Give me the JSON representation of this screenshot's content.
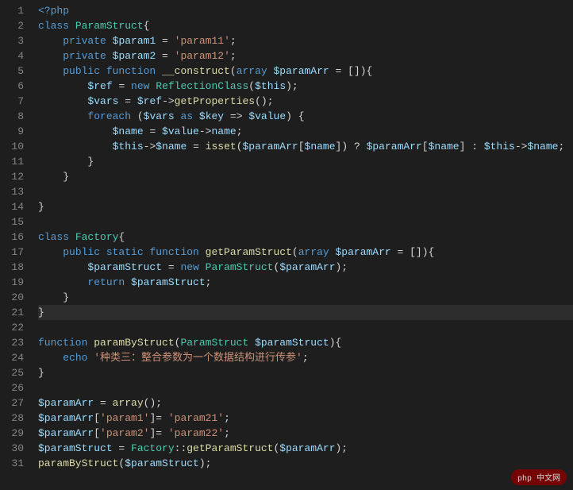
{
  "lines": [
    {
      "n": 1,
      "tokens": [
        {
          "t": "<?php",
          "c": "tok-keyword"
        }
      ]
    },
    {
      "n": 2,
      "tokens": [
        {
          "t": "class ",
          "c": "tok-keyword"
        },
        {
          "t": "ParamStruct",
          "c": "tok-type"
        },
        {
          "t": "{",
          "c": "tok-punct"
        }
      ]
    },
    {
      "n": 3,
      "indent": 1,
      "tokens": [
        {
          "t": "private ",
          "c": "tok-keyword"
        },
        {
          "t": "$param1",
          "c": "tok-var"
        },
        {
          "t": " = ",
          "c": "tok-op"
        },
        {
          "t": "'param11'",
          "c": "tok-string"
        },
        {
          "t": ";",
          "c": "tok-punct"
        }
      ]
    },
    {
      "n": 4,
      "indent": 1,
      "tokens": [
        {
          "t": "private ",
          "c": "tok-keyword"
        },
        {
          "t": "$param2",
          "c": "tok-var"
        },
        {
          "t": " = ",
          "c": "tok-op"
        },
        {
          "t": "'param12'",
          "c": "tok-string"
        },
        {
          "t": ";",
          "c": "tok-punct"
        }
      ]
    },
    {
      "n": 5,
      "indent": 1,
      "tokens": [
        {
          "t": "public ",
          "c": "tok-keyword"
        },
        {
          "t": "function ",
          "c": "tok-keyword"
        },
        {
          "t": "__construct",
          "c": "tok-func"
        },
        {
          "t": "(",
          "c": "tok-punct"
        },
        {
          "t": "array ",
          "c": "tok-keyword"
        },
        {
          "t": "$paramArr",
          "c": "tok-var"
        },
        {
          "t": " = []",
          "c": "tok-op"
        },
        {
          "t": "){",
          "c": "tok-punct"
        }
      ]
    },
    {
      "n": 6,
      "indent": 2,
      "tokens": [
        {
          "t": "$ref",
          "c": "tok-var"
        },
        {
          "t": " = ",
          "c": "tok-op"
        },
        {
          "t": "new ",
          "c": "tok-keyword"
        },
        {
          "t": "ReflectionClass",
          "c": "tok-type"
        },
        {
          "t": "(",
          "c": "tok-punct"
        },
        {
          "t": "$this",
          "c": "tok-var"
        },
        {
          "t": ");",
          "c": "tok-punct"
        }
      ]
    },
    {
      "n": 7,
      "indent": 2,
      "tokens": [
        {
          "t": "$vars",
          "c": "tok-var"
        },
        {
          "t": " = ",
          "c": "tok-op"
        },
        {
          "t": "$ref",
          "c": "tok-var"
        },
        {
          "t": "->",
          "c": "tok-op"
        },
        {
          "t": "getProperties",
          "c": "tok-func"
        },
        {
          "t": "();",
          "c": "tok-punct"
        }
      ]
    },
    {
      "n": 8,
      "indent": 2,
      "tokens": [
        {
          "t": "foreach ",
          "c": "tok-keyword"
        },
        {
          "t": "(",
          "c": "tok-punct"
        },
        {
          "t": "$vars",
          "c": "tok-var"
        },
        {
          "t": " as ",
          "c": "tok-keyword"
        },
        {
          "t": "$key",
          "c": "tok-var"
        },
        {
          "t": " => ",
          "c": "tok-op"
        },
        {
          "t": "$value",
          "c": "tok-var"
        },
        {
          "t": ") {",
          "c": "tok-punct"
        }
      ]
    },
    {
      "n": 9,
      "indent": 3,
      "tokens": [
        {
          "t": "$name",
          "c": "tok-var"
        },
        {
          "t": " = ",
          "c": "tok-op"
        },
        {
          "t": "$value",
          "c": "tok-var"
        },
        {
          "t": "->",
          "c": "tok-op"
        },
        {
          "t": "name",
          "c": "tok-var"
        },
        {
          "t": ";",
          "c": "tok-punct"
        }
      ]
    },
    {
      "n": 10,
      "indent": 3,
      "tokens": [
        {
          "t": "$this",
          "c": "tok-var"
        },
        {
          "t": "->",
          "c": "tok-op"
        },
        {
          "t": "$name",
          "c": "tok-var"
        },
        {
          "t": " = ",
          "c": "tok-op"
        },
        {
          "t": "isset",
          "c": "tok-func"
        },
        {
          "t": "(",
          "c": "tok-punct"
        },
        {
          "t": "$paramArr",
          "c": "tok-var"
        },
        {
          "t": "[",
          "c": "tok-punct"
        },
        {
          "t": "$name",
          "c": "tok-var"
        },
        {
          "t": "]) ? ",
          "c": "tok-punct"
        },
        {
          "t": "$paramArr",
          "c": "tok-var"
        },
        {
          "t": "[",
          "c": "tok-punct"
        },
        {
          "t": "$name",
          "c": "tok-var"
        },
        {
          "t": "] : ",
          "c": "tok-punct"
        },
        {
          "t": "$this",
          "c": "tok-var"
        },
        {
          "t": "->",
          "c": "tok-op"
        },
        {
          "t": "$name",
          "c": "tok-var"
        },
        {
          "t": ";",
          "c": "tok-punct"
        }
      ]
    },
    {
      "n": 11,
      "indent": 2,
      "tokens": [
        {
          "t": "}",
          "c": "tok-punct"
        }
      ]
    },
    {
      "n": 12,
      "indent": 1,
      "tokens": [
        {
          "t": "}",
          "c": "tok-punct"
        }
      ]
    },
    {
      "n": 13,
      "tokens": []
    },
    {
      "n": 14,
      "tokens": [
        {
          "t": "}",
          "c": "tok-punct"
        }
      ]
    },
    {
      "n": 15,
      "tokens": []
    },
    {
      "n": 16,
      "tokens": [
        {
          "t": "class ",
          "c": "tok-keyword"
        },
        {
          "t": "Factory",
          "c": "tok-type"
        },
        {
          "t": "{",
          "c": "tok-punct"
        }
      ]
    },
    {
      "n": 17,
      "indent": 1,
      "tokens": [
        {
          "t": "public ",
          "c": "tok-keyword"
        },
        {
          "t": "static ",
          "c": "tok-keyword"
        },
        {
          "t": "function ",
          "c": "tok-keyword"
        },
        {
          "t": "getParamStruct",
          "c": "tok-func"
        },
        {
          "t": "(",
          "c": "tok-punct"
        },
        {
          "t": "array ",
          "c": "tok-keyword"
        },
        {
          "t": "$paramArr",
          "c": "tok-var"
        },
        {
          "t": " = []",
          "c": "tok-op"
        },
        {
          "t": "){",
          "c": "tok-punct"
        }
      ]
    },
    {
      "n": 18,
      "indent": 2,
      "tokens": [
        {
          "t": "$paramStruct",
          "c": "tok-var"
        },
        {
          "t": " = ",
          "c": "tok-op"
        },
        {
          "t": "new ",
          "c": "tok-keyword"
        },
        {
          "t": "ParamStruct",
          "c": "tok-type"
        },
        {
          "t": "(",
          "c": "tok-punct"
        },
        {
          "t": "$paramArr",
          "c": "tok-var"
        },
        {
          "t": ");",
          "c": "tok-punct"
        }
      ]
    },
    {
      "n": 19,
      "indent": 2,
      "tokens": [
        {
          "t": "return ",
          "c": "tok-keyword"
        },
        {
          "t": "$paramStruct",
          "c": "tok-var"
        },
        {
          "t": ";",
          "c": "tok-punct"
        }
      ]
    },
    {
      "n": 20,
      "indent": 1,
      "tokens": [
        {
          "t": "}",
          "c": "tok-punct"
        }
      ]
    },
    {
      "n": 21,
      "hl": true,
      "tokens": [
        {
          "t": "}",
          "c": "tok-punct"
        }
      ]
    },
    {
      "n": 22,
      "tokens": []
    },
    {
      "n": 23,
      "tokens": [
        {
          "t": "function ",
          "c": "tok-keyword"
        },
        {
          "t": "paramByStruct",
          "c": "tok-func"
        },
        {
          "t": "(",
          "c": "tok-punct"
        },
        {
          "t": "ParamStruct ",
          "c": "tok-type"
        },
        {
          "t": "$paramStruct",
          "c": "tok-var"
        },
        {
          "t": "){",
          "c": "tok-punct"
        }
      ]
    },
    {
      "n": 24,
      "indent": 1,
      "tokens": [
        {
          "t": "echo ",
          "c": "tok-keyword"
        },
        {
          "t": "'种类三：整合参数为一个数据结构进行传参'",
          "c": "tok-string"
        },
        {
          "t": ";",
          "c": "tok-punct"
        }
      ]
    },
    {
      "n": 25,
      "tokens": [
        {
          "t": "}",
          "c": "tok-punct"
        }
      ]
    },
    {
      "n": 26,
      "tokens": []
    },
    {
      "n": 27,
      "tokens": [
        {
          "t": "$paramArr",
          "c": "tok-var"
        },
        {
          "t": " = ",
          "c": "tok-op"
        },
        {
          "t": "array",
          "c": "tok-func"
        },
        {
          "t": "();",
          "c": "tok-punct"
        }
      ]
    },
    {
      "n": 28,
      "tokens": [
        {
          "t": "$paramArr",
          "c": "tok-var"
        },
        {
          "t": "[",
          "c": "tok-punct"
        },
        {
          "t": "'param1'",
          "c": "tok-string"
        },
        {
          "t": "]= ",
          "c": "tok-punct"
        },
        {
          "t": "'param21'",
          "c": "tok-string"
        },
        {
          "t": ";",
          "c": "tok-punct"
        }
      ]
    },
    {
      "n": 29,
      "tokens": [
        {
          "t": "$paramArr",
          "c": "tok-var"
        },
        {
          "t": "[",
          "c": "tok-punct"
        },
        {
          "t": "'param2'",
          "c": "tok-string"
        },
        {
          "t": "]= ",
          "c": "tok-punct"
        },
        {
          "t": "'param22'",
          "c": "tok-string"
        },
        {
          "t": ";",
          "c": "tok-punct"
        }
      ]
    },
    {
      "n": 30,
      "tokens": [
        {
          "t": "$paramStruct",
          "c": "tok-var"
        },
        {
          "t": " = ",
          "c": "tok-op"
        },
        {
          "t": "Factory",
          "c": "tok-type"
        },
        {
          "t": "::",
          "c": "tok-op"
        },
        {
          "t": "getParamStruct",
          "c": "tok-func"
        },
        {
          "t": "(",
          "c": "tok-punct"
        },
        {
          "t": "$paramArr",
          "c": "tok-var"
        },
        {
          "t": ");",
          "c": "tok-punct"
        }
      ]
    },
    {
      "n": 31,
      "tokens": [
        {
          "t": "paramByStruct",
          "c": "tok-func"
        },
        {
          "t": "(",
          "c": "tok-punct"
        },
        {
          "t": "$paramStruct",
          "c": "tok-var"
        },
        {
          "t": ");",
          "c": "tok-punct"
        }
      ]
    }
  ],
  "watermark": "php 中文网"
}
